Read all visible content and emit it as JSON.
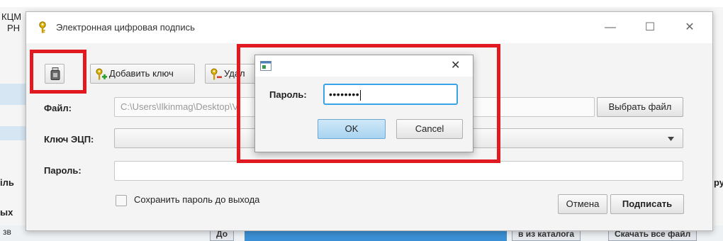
{
  "background": {
    "left_text_1": "КЦМ",
    "left_text_2": "РН",
    "left_text_3": "іль",
    "left_text_4": "ых",
    "left_text_5": "зв",
    "right_text": "ру",
    "bottom_btn_1": "До",
    "bottom_btn_2": "в из каталога",
    "bottom_btn_3": "Скачать все файл"
  },
  "window": {
    "title": "Электронная цифровая подпись",
    "minimize": "—",
    "maximize": "☐",
    "close": "✕"
  },
  "toolbar": {
    "add_key_label": "Добавить ключ",
    "delete_key_label": "Удал"
  },
  "form": {
    "file_label": "Файл:",
    "file_value": "C:\\Users\\Ilkinmag\\Desktop\\",
    "file_suffix": "V",
    "choose_file": "Выбрать файл",
    "key_label": "Ключ ЭЦП:",
    "password_label": "Пароль:",
    "save_password": "Сохранить пароль до выхода",
    "cancel": "Отмена",
    "sign": "Подписать"
  },
  "dialog": {
    "close": "✕",
    "password_label": "Пароль:",
    "password_value": "••••••••",
    "ok": "OK",
    "cancel": "Cancel"
  },
  "colors": {
    "highlight": "#e11a22",
    "focus": "#39a3e8",
    "ok_button": "#b9dcf3"
  }
}
